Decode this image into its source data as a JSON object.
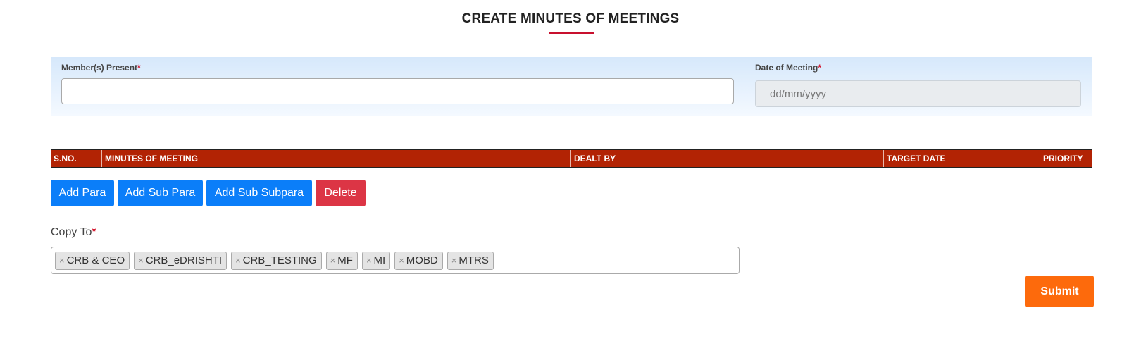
{
  "page": {
    "title": "CREATE MINUTES OF MEETINGS"
  },
  "form": {
    "members_label": "Member(s) Present",
    "members_value": "",
    "date_label": "Date of Meeting",
    "date_placeholder": "dd/mm/yyyy",
    "required_mark": "*"
  },
  "table": {
    "headers": [
      "S.NO.",
      "MINUTES OF MEETING",
      "DEALT BY",
      "TARGET DATE",
      "PRIORITY"
    ]
  },
  "actions": {
    "add_para": "Add Para",
    "add_sub_para": "Add Sub Para",
    "add_sub_subpara": "Add Sub Subpara",
    "delete": "Delete"
  },
  "copy_to": {
    "label": "Copy To",
    "remove_glyph": "×",
    "tags": [
      "CRB & CEO",
      "CRB_eDRISHTI",
      "CRB_TESTING",
      "MF",
      "MI",
      "MOBD",
      "MTRS"
    ]
  },
  "submit": {
    "label": "Submit"
  },
  "colors": {
    "accent_red": "#c8102e",
    "table_header": "#b22304",
    "primary_blue": "#0b7ef9",
    "danger_red": "#dc3545",
    "submit_orange": "#fd6a0c"
  }
}
